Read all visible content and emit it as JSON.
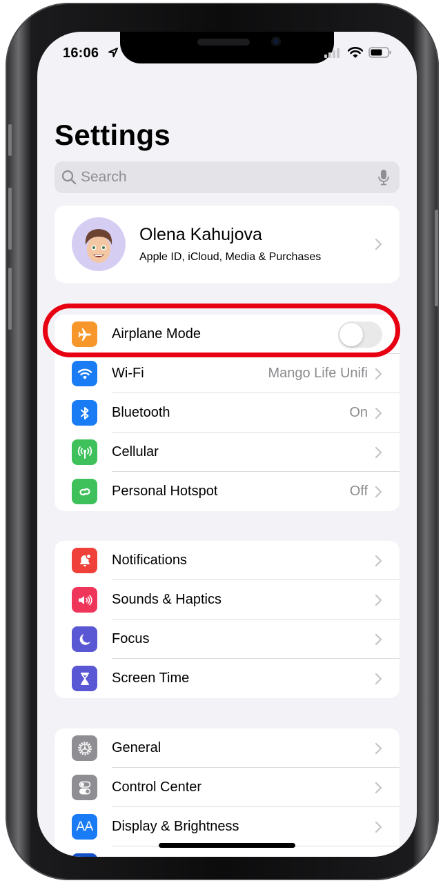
{
  "status_bar": {
    "time": "16:06",
    "location_icon": "location-arrow-icon",
    "signal_icon": "cellular-signal-icon",
    "wifi_icon": "wifi-icon",
    "battery_icon": "battery-icon"
  },
  "header": {
    "title": "Settings"
  },
  "search": {
    "placeholder": "Search",
    "value": "",
    "icon": "search-icon",
    "mic_icon": "microphone-icon"
  },
  "profile": {
    "name": "Olena Kahujova",
    "subtitle": "Apple ID, iCloud, Media & Purchases",
    "avatar": "memoji-avatar"
  },
  "groups": [
    {
      "items": [
        {
          "label": "Airplane Mode",
          "icon": "airplane-icon",
          "color": "#f7972b",
          "control": "toggle",
          "toggle_on": false
        },
        {
          "label": "Wi-Fi",
          "icon": "wifi-icon",
          "color": "#1a7cf5",
          "value": "Mango Life Unifi"
        },
        {
          "label": "Bluetooth",
          "icon": "bluetooth-icon",
          "color": "#1a7cf5",
          "value": "On"
        },
        {
          "label": "Cellular",
          "icon": "antenna-icon",
          "color": "#3ec15b",
          "value": ""
        },
        {
          "label": "Personal Hotspot",
          "icon": "hotspot-link-icon",
          "color": "#3ec15b",
          "value": "Off"
        }
      ]
    },
    {
      "items": [
        {
          "label": "Notifications",
          "icon": "bell-icon",
          "color": "#f0403a"
        },
        {
          "label": "Sounds & Haptics",
          "icon": "speaker-icon",
          "color": "#f0355a"
        },
        {
          "label": "Focus",
          "icon": "moon-icon",
          "color": "#5a57d4"
        },
        {
          "label": "Screen Time",
          "icon": "hourglass-icon",
          "color": "#5a57d4"
        }
      ]
    },
    {
      "items": [
        {
          "label": "General",
          "icon": "gear-icon",
          "color": "#8e8e93"
        },
        {
          "label": "Control Center",
          "icon": "switches-icon",
          "color": "#8e8e93"
        },
        {
          "label": "Display & Brightness",
          "icon": "text-size-icon",
          "color": "#1a7cf5",
          "glyph": "AA"
        }
      ]
    }
  ],
  "annotation": {
    "highlight_color": "#e60012",
    "target": "Airplane Mode"
  }
}
